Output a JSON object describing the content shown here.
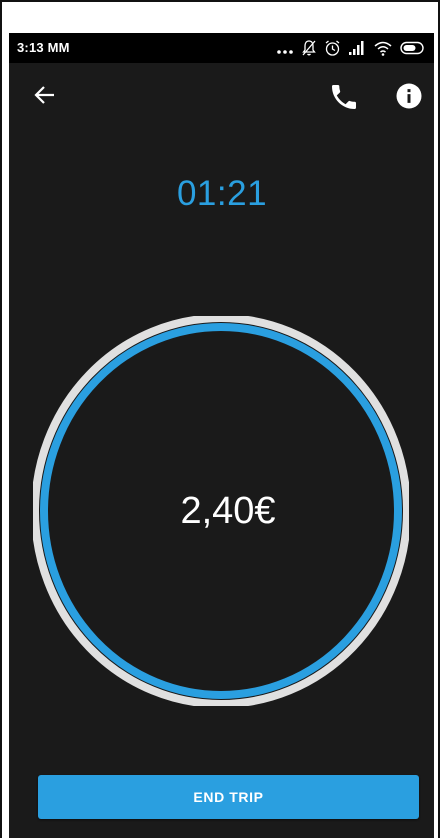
{
  "status_bar": {
    "time": "3:13 MM",
    "icons": [
      "more-dots-icon",
      "muted-bell-icon",
      "alarm-icon",
      "signal-icon",
      "wifi-icon",
      "battery-icon"
    ]
  },
  "toolbar": {
    "back_icon": "arrow-left-icon",
    "phone_icon": "phone-icon",
    "info_icon": "info-icon"
  },
  "trip": {
    "timer": "01:21",
    "fare": "2,40€",
    "end_label": "END TRIP"
  },
  "colors": {
    "accent": "#2a9fe0",
    "background": "#1a1a1a",
    "ring_outer": "#e0e0e0",
    "status_bar": "#000000"
  }
}
